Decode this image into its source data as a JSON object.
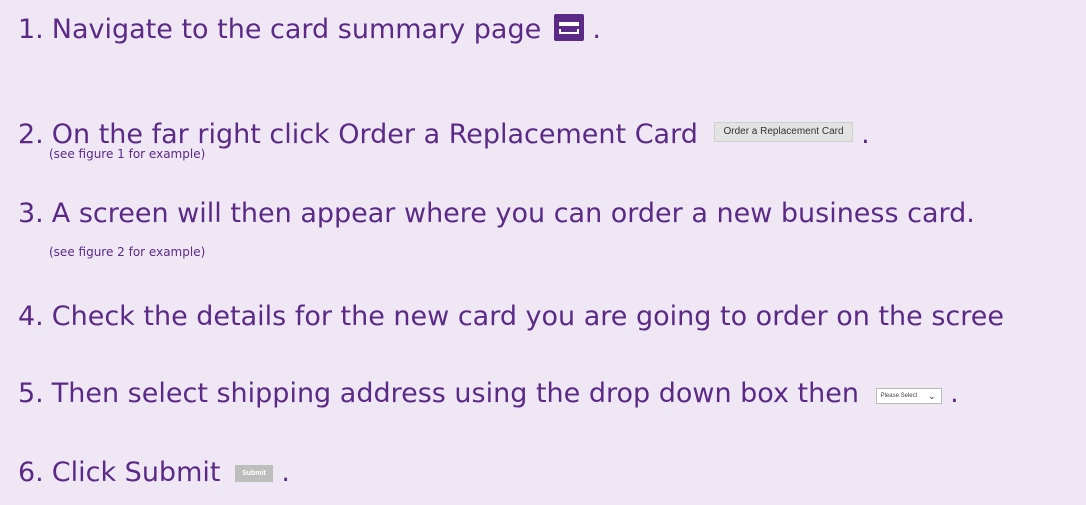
{
  "steps": [
    {
      "num": "1.",
      "text": "Navigate to the card summary page",
      "end": "."
    },
    {
      "num": "2.",
      "text": "On the far right click Order a Replacement Card",
      "button": "Order a Replacement Card",
      "end": ".",
      "note": "(see figure 1 for example)"
    },
    {
      "num": "3.",
      "text": "A screen will then appear where you can order a new business card.",
      "note": "(see figure 2 for example)"
    },
    {
      "num": "4.",
      "text": "Check the details for the new card you are going to order on the scree"
    },
    {
      "num": "5.",
      "text": "Then select shipping address using the drop down box then",
      "select": "Please Select",
      "end": "."
    },
    {
      "num": "6.",
      "text": "Click Submit",
      "button": "Submit",
      "end": "."
    }
  ],
  "icons": {
    "card_summary": "credit-card-icon",
    "dropdown": "chevron-down-icon"
  },
  "colors": {
    "text": "#5b2a86",
    "background": "#f0e7f4"
  }
}
